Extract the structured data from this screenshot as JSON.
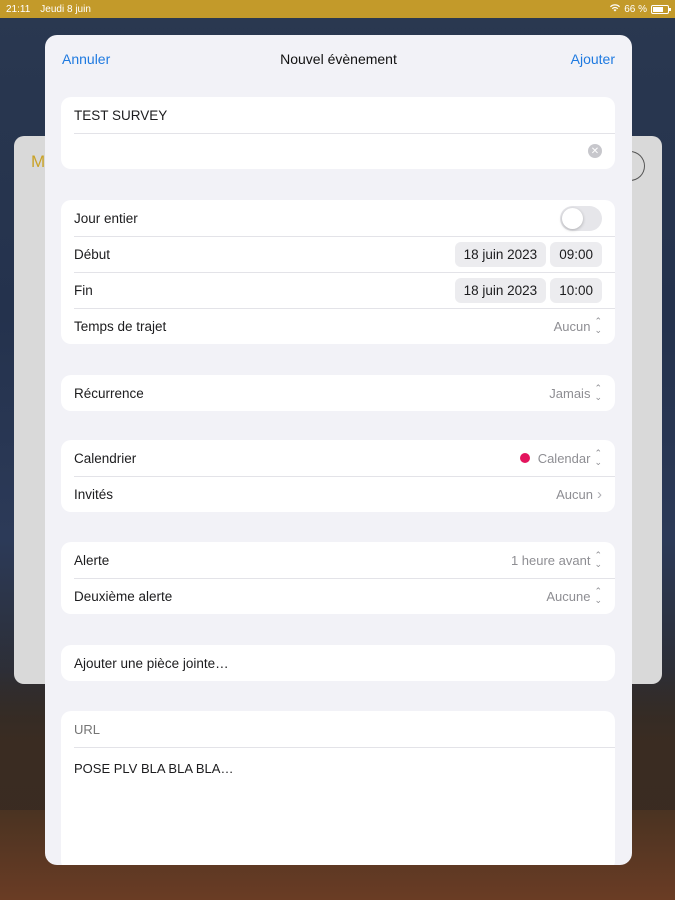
{
  "status_bar": {
    "time": "21:11",
    "date": "Jeudi 8 juin",
    "battery": "66 %"
  },
  "background_app": {
    "partial_title": "M"
  },
  "sheet": {
    "cancel_label": "Annuler",
    "title": "Nouvel évènement",
    "add_label": "Ajouter",
    "event_title_value": "TEST SURVEY",
    "location_placeholder": "",
    "all_day": {
      "label": "Jour entier",
      "on": false
    },
    "start": {
      "label": "Début",
      "date": "18 juin 2023",
      "time": "09:00"
    },
    "end": {
      "label": "Fin",
      "date": "18 juin 2023",
      "time": "10:00"
    },
    "travel_time": {
      "label": "Temps de trajet",
      "value": "Aucun"
    },
    "recurrence": {
      "label": "Récurrence",
      "value": "Jamais"
    },
    "calendar": {
      "label": "Calendrier",
      "value": "Calendar",
      "color": "#e3145d"
    },
    "invitees": {
      "label": "Invités",
      "value": "Aucun"
    },
    "alert": {
      "label": "Alerte",
      "value": "1 heure avant"
    },
    "second_alert": {
      "label": "Deuxième alerte",
      "value": "Aucune"
    },
    "attachment": {
      "label": "Ajouter une pièce jointe…"
    },
    "url_placeholder": "URL",
    "notes": "POSE PLV BLA BLA BLA…"
  },
  "colors": {
    "accent": "#1f7ae0",
    "status_bar": "#c39a2a",
    "calendar_dot": "#e3145d"
  }
}
